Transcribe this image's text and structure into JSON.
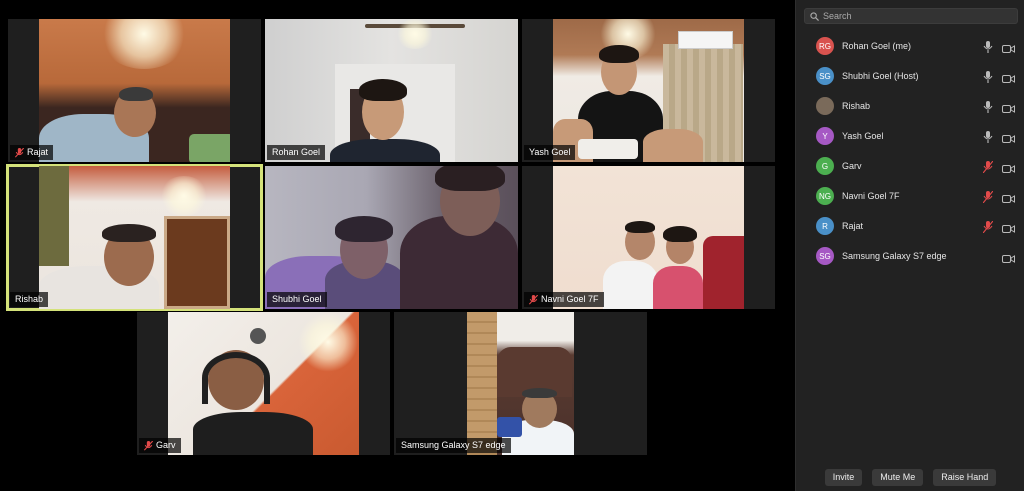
{
  "colors": {
    "accent_active": "#d4e27a",
    "panel_bg": "#222222",
    "muted_red": "#e24a4a"
  },
  "tiles": [
    {
      "name": "Rajat",
      "muted": true,
      "active": false
    },
    {
      "name": "Rohan Goel",
      "muted": false,
      "active": false
    },
    {
      "name": "Yash Goel",
      "muted": false,
      "active": false
    },
    {
      "name": "Rishab",
      "muted": false,
      "active": true
    },
    {
      "name": "Shubhi Goel",
      "muted": false,
      "active": false
    },
    {
      "name": "Navni Goel  7F",
      "muted": true,
      "active": false
    },
    {
      "name": "Garv",
      "muted": true,
      "active": false
    },
    {
      "name": "Samsung Galaxy S7 edge",
      "muted": false,
      "active": false
    }
  ],
  "panel": {
    "search_placeholder": "Search",
    "participants": [
      {
        "initials": "RG",
        "name": "Rohan Goel (me)",
        "avatar_color": "#d9534f",
        "mic": "on",
        "cam": "on"
      },
      {
        "initials": "SG",
        "name": "Shubhi Goel (Host)",
        "avatar_color": "#4a90c8",
        "mic": "on",
        "cam": "on"
      },
      {
        "initials": "",
        "name": "Rishab",
        "avatar_color": "#7a6a5a",
        "mic": "on",
        "cam": "on"
      },
      {
        "initials": "Y",
        "name": "Yash Goel",
        "avatar_color": "#a659c4",
        "mic": "on",
        "cam": "on"
      },
      {
        "initials": "G",
        "name": "Garv",
        "avatar_color": "#4caf50",
        "mic": "muted",
        "cam": "on"
      },
      {
        "initials": "NG",
        "name": "Navni Goel  7F",
        "avatar_color": "#4caf50",
        "mic": "muted",
        "cam": "on"
      },
      {
        "initials": "R",
        "name": "Rajat",
        "avatar_color": "#4a90c8",
        "mic": "muted",
        "cam": "on"
      },
      {
        "initials": "SG",
        "name": "Samsung Galaxy S7 edge",
        "avatar_color": "#a659c4",
        "mic": "none",
        "cam": "on"
      }
    ],
    "buttons": {
      "invite": "Invite",
      "mute_me": "Mute Me",
      "raise_hand": "Raise Hand"
    }
  }
}
